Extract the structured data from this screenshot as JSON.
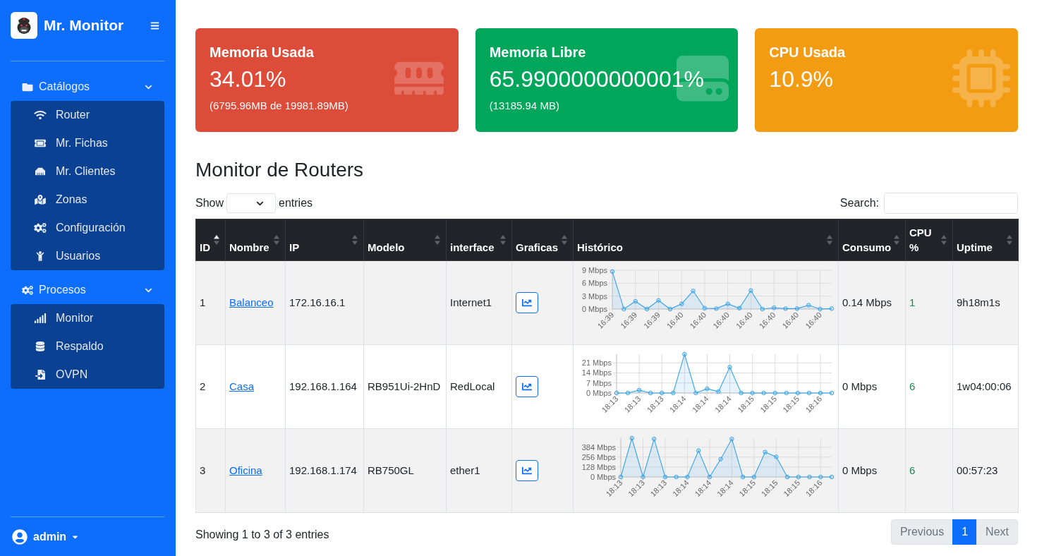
{
  "sidebar": {
    "brand": "Mr. Monitor",
    "sections": [
      {
        "label": "Catálogos",
        "expanded": true,
        "items": [
          {
            "label": "Router"
          },
          {
            "label": "Mr. Fichas"
          },
          {
            "label": "Mr. Clientes"
          },
          {
            "label": "Zonas"
          },
          {
            "label": "Configuración"
          },
          {
            "label": "Usuarios"
          }
        ]
      },
      {
        "label": "Procesos",
        "expanded": true,
        "items": [
          {
            "label": "Monitor"
          },
          {
            "label": "Respaldo"
          },
          {
            "label": "OVPN"
          }
        ]
      }
    ],
    "user": {
      "name": "admin"
    }
  },
  "cards": [
    {
      "title": "Memoria Usada",
      "value": "34.01%",
      "detail": "(6795.96MB de 19981.89MB)",
      "color": "#dd4b39"
    },
    {
      "title": "Memoria Libre",
      "value": "65.9900000000001%",
      "detail": "(13185.94 MB)",
      "color": "#00a65a"
    },
    {
      "title": "CPU Usada",
      "value": "10.9%",
      "color": "#f39c12"
    }
  ],
  "page_title": "Monitor de Routers",
  "table_controls": {
    "show_label": "Show",
    "entries_label": "entries",
    "search_label": "Search:"
  },
  "table": {
    "columns": [
      {
        "label": "ID",
        "sorted": true
      },
      {
        "label": "Nombre",
        "sorted": false
      },
      {
        "label": "IP",
        "sorted": false
      },
      {
        "label": "Modelo",
        "sorted": false
      },
      {
        "label": "interface",
        "sorted": false
      },
      {
        "label": "Graficas",
        "sorted": false
      },
      {
        "label": "Histórico",
        "sorted": false
      },
      {
        "label": "Consumo",
        "sorted": false
      },
      {
        "label": "CPU %",
        "sorted": false
      },
      {
        "label": "Uptime",
        "sorted": false
      }
    ],
    "rows": [
      {
        "id": "1",
        "name": "Balanceo",
        "ip": "172.16.16.1",
        "interface": "Internet1",
        "history": {
          "chart_data": {
            "type": "area",
            "grid": true,
            "categories": [
              "16:39",
              null,
              "16:39",
              null,
              "16:39",
              null,
              "16:40",
              null,
              "16:40",
              null,
              "16:40",
              null,
              "16:40",
              null,
              "16:40",
              null,
              "16:40",
              null,
              "16:40",
              null
            ],
            "series": [
              {
                "color": "#36a2eb",
                "values": [
                  8.7,
                  0,
                  1.8,
                  0,
                  2.0,
                  0,
                  1.2,
                  4.2,
                  0.2,
                  0.1,
                  1.2,
                  0.2,
                  4.3,
                  0,
                  0.3,
                  0.1,
                  0.1,
                  0.9,
                  0,
                  0.1
                ]
              }
            ],
            "yticks": [
              {
                "value": 0,
                "label": "0 Mbps"
              },
              {
                "value": 3,
                "label": "3 Mbps"
              },
              {
                "value": 6,
                "label": "6 Mbps"
              },
              {
                "value": 9,
                "label": "9 Mbps"
              }
            ],
            "ylim": [
              0,
              9
            ]
          }
        },
        "consumption": "0.14 Mbps",
        "cpu": "1",
        "uptime": "9h18m1s"
      },
      {
        "id": "2",
        "name": "Casa",
        "ip": "192.168.1.164",
        "model": "RB951Ui-2HnD",
        "interface": "RedLocal",
        "history": {
          "chart_data": {
            "type": "area",
            "grid": true,
            "categories": [
              "18:13",
              null,
              "18:13",
              null,
              "18:13",
              null,
              "18:14",
              null,
              "18:14",
              null,
              "18:14",
              null,
              "18:15",
              null,
              "18:15",
              null,
              "18:15",
              null,
              "18:16",
              null
            ],
            "series": [
              {
                "color": "#36a2eb",
                "values": [
                  0,
                  0,
                  2,
                  0,
                  0,
                  0,
                  27,
                  0,
                  3,
                  1,
                  18,
                  0,
                  0,
                  0,
                  0,
                  0,
                  0,
                  0,
                  0,
                  0
                ]
              }
            ],
            "yticks": [
              {
                "value": 0,
                "label": "0 Mbps"
              },
              {
                "value": 7,
                "label": "7 Mbps"
              },
              {
                "value": 14,
                "label": "14 Mbps"
              },
              {
                "value": 21,
                "label": "21 Mbps"
              }
            ],
            "ylim": [
              0,
              27
            ]
          }
        },
        "consumption": "0 Mbps",
        "cpu": "6",
        "uptime": "1w04:00:06"
      },
      {
        "id": "3",
        "name": "Oficina",
        "ip": "192.168.1.174",
        "model": "RB750GL",
        "interface": "ether1",
        "history": {
          "chart_data": {
            "type": "area",
            "grid": true,
            "categories": [
              "18:13",
              null,
              "18:13",
              null,
              "18:13",
              null,
              "18:14",
              null,
              "18:14",
              null,
              "18:14",
              null,
              "18:15",
              null,
              "18:15",
              null,
              "18:15",
              null,
              "18:16",
              null
            ],
            "series": [
              {
                "color": "#36a2eb",
                "values": [
                  0,
                  500,
                  0,
                  490,
                  0,
                  0,
                  0,
                  340,
                  0,
                  230,
                  490,
                  0,
                  0,
                  320,
                  260,
                  0,
                  0,
                  0,
                  0,
                  0
                ]
              }
            ],
            "yticks": [
              {
                "value": 0,
                "label": "0 Mbps"
              },
              {
                "value": 128,
                "label": "128 Mbps"
              },
              {
                "value": 256,
                "label": "256 Mbps"
              },
              {
                "value": 384,
                "label": "384 Mbps"
              }
            ],
            "ylim": [
              0,
              500
            ]
          }
        },
        "consumption": "0 Mbps",
        "cpu": "6",
        "uptime": "00:57:23"
      }
    ]
  },
  "table_info": "Showing 1 to 3 of 3 entries",
  "pagination": [
    {
      "label": "Previous",
      "selected": false,
      "disabled": true
    },
    {
      "label": "1",
      "selected": true,
      "disabled": false
    },
    {
      "label": "Next",
      "selected": false,
      "disabled": true
    }
  ]
}
